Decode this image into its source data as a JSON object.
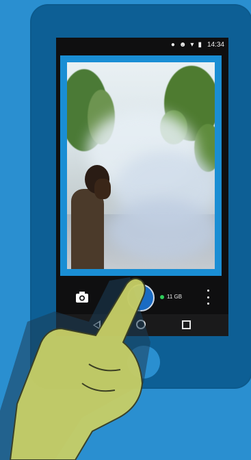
{
  "status_bar": {
    "icons": [
      "location-icon",
      "alarm-icon",
      "wifi-icon",
      "battery-icon"
    ],
    "time": "14:34"
  },
  "camera": {
    "storage_text": "11 GB",
    "storage_status_color": "#2ecc5a",
    "shutter_color": "#1a6bc3"
  },
  "navigation": {
    "buttons": [
      "back",
      "home",
      "recent-apps"
    ]
  },
  "colors": {
    "background": "#2a8fd0",
    "device": "#0d5f95",
    "frame": "#1a8ed4",
    "hand": "#c5cd66"
  }
}
